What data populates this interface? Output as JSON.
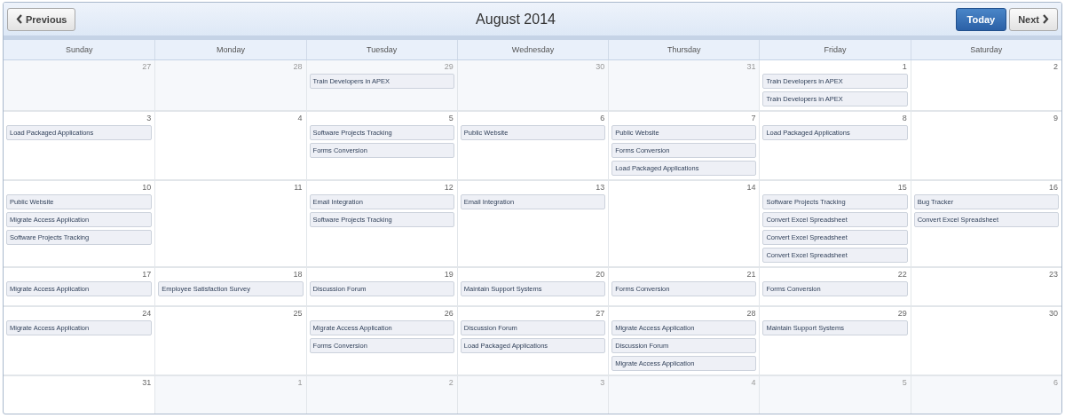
{
  "toolbar": {
    "previous": "Previous",
    "title": "August 2014",
    "today": "Today",
    "next": "Next"
  },
  "weekdays": [
    "Sunday",
    "Monday",
    "Tuesday",
    "Wednesday",
    "Thursday",
    "Friday",
    "Saturday"
  ],
  "weeks": [
    [
      {
        "day": "27",
        "other_month": true
      },
      {
        "day": "28",
        "other_month": true
      },
      {
        "day": "29",
        "other_month": true,
        "events": [
          "Train Developers in APEX"
        ]
      },
      {
        "day": "30",
        "other_month": true
      },
      {
        "day": "31",
        "other_month": true
      },
      {
        "day": "1",
        "other_month": false,
        "events": [
          "Train Developers in APEX",
          "Train Developers in APEX"
        ]
      },
      {
        "day": "2",
        "other_month": false
      }
    ],
    [
      {
        "day": "3",
        "other_month": false,
        "events": [
          "Load Packaged Applications"
        ]
      },
      {
        "day": "4",
        "other_month": false
      },
      {
        "day": "5",
        "other_month": false,
        "events": [
          "Software Projects Tracking",
          "Forms Conversion"
        ]
      },
      {
        "day": "6",
        "other_month": false,
        "events": [
          "Public Website"
        ]
      },
      {
        "day": "7",
        "other_month": false,
        "events": [
          "Public Website",
          "Forms Conversion",
          "Load Packaged Applications"
        ]
      },
      {
        "day": "8",
        "other_month": false,
        "events": [
          "Load Packaged Applications"
        ]
      },
      {
        "day": "9",
        "other_month": false
      }
    ],
    [
      {
        "day": "10",
        "other_month": false,
        "events": [
          "Public Website",
          "Migrate Access Application",
          "Software Projects Tracking"
        ]
      },
      {
        "day": "11",
        "other_month": false
      },
      {
        "day": "12",
        "other_month": false,
        "events": [
          "Email Integration",
          "Software Projects Tracking"
        ]
      },
      {
        "day": "13",
        "other_month": false,
        "events": [
          "Email Integration"
        ]
      },
      {
        "day": "14",
        "other_month": false
      },
      {
        "day": "15",
        "other_month": false,
        "events": [
          "Software Projects Tracking",
          "Convert Excel Spreadsheet",
          "Convert Excel Spreadsheet",
          "Convert Excel Spreadsheet"
        ]
      },
      {
        "day": "16",
        "other_month": false,
        "events": [
          "Bug Tracker",
          "Convert Excel Spreadsheet"
        ]
      }
    ],
    [
      {
        "day": "17",
        "other_month": false,
        "events": [
          "Migrate Access Application"
        ]
      },
      {
        "day": "18",
        "other_month": false,
        "events": [
          "Employee Satisfaction Survey"
        ]
      },
      {
        "day": "19",
        "other_month": false,
        "events": [
          "Discussion Forum"
        ]
      },
      {
        "day": "20",
        "other_month": false,
        "events": [
          "Maintain Support Systems"
        ]
      },
      {
        "day": "21",
        "other_month": false,
        "events": [
          "Forms Conversion"
        ]
      },
      {
        "day": "22",
        "other_month": false,
        "events": [
          "Forms Conversion"
        ]
      },
      {
        "day": "23",
        "other_month": false
      }
    ],
    [
      {
        "day": "24",
        "other_month": false,
        "events": [
          "Migrate Access Application"
        ]
      },
      {
        "day": "25",
        "other_month": false
      },
      {
        "day": "26",
        "other_month": false,
        "events": [
          "Migrate Access Application",
          "Forms Conversion"
        ]
      },
      {
        "day": "27",
        "other_month": false,
        "events": [
          "Discussion Forum",
          "Load Packaged Applications"
        ]
      },
      {
        "day": "28",
        "other_month": false,
        "events": [
          "Migrate Access Application",
          "Discussion Forum",
          "Migrate Access Application"
        ]
      },
      {
        "day": "29",
        "other_month": false,
        "events": [
          "Maintain Support Systems"
        ]
      },
      {
        "day": "30",
        "other_month": false
      }
    ],
    [
      {
        "day": "31",
        "other_month": false
      },
      {
        "day": "1",
        "other_month": true
      },
      {
        "day": "2",
        "other_month": true
      },
      {
        "day": "3",
        "other_month": true
      },
      {
        "day": "4",
        "other_month": true
      },
      {
        "day": "5",
        "other_month": true
      },
      {
        "day": "6",
        "other_month": true
      }
    ]
  ]
}
